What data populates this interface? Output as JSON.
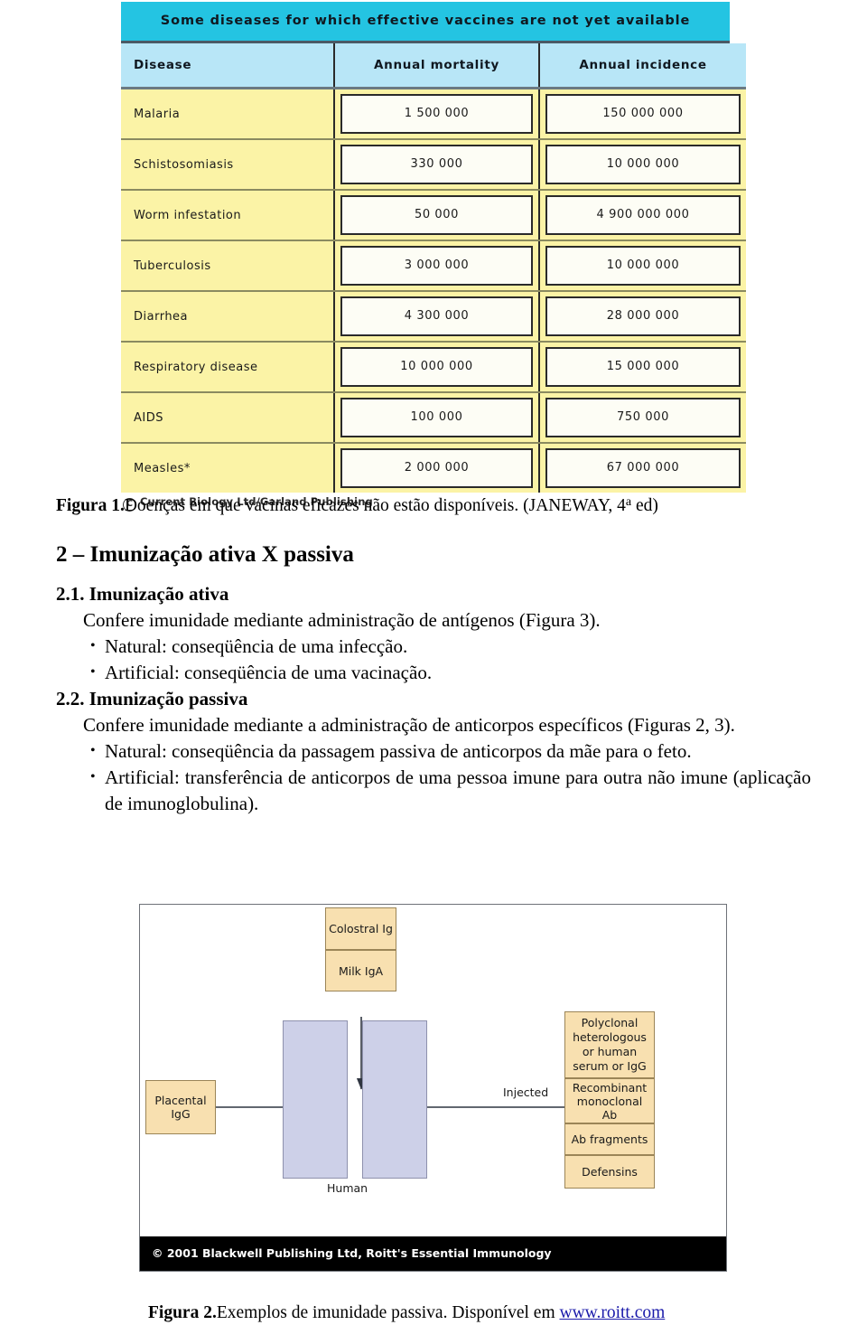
{
  "figure1": {
    "table_title": "Some diseases for which effective vaccines are not yet available",
    "columns": [
      "Disease",
      "Annual mortality",
      "Annual incidence"
    ],
    "rows": [
      {
        "disease": "Malaria",
        "mortality": "1 500 000",
        "incidence": "150 000 000"
      },
      {
        "disease": "Schistosomiasis",
        "mortality": "330 000",
        "incidence": "10 000 000"
      },
      {
        "disease": "Worm  infestation",
        "mortality": "50 000",
        "incidence": "4 900 000 000"
      },
      {
        "disease": "Tuberculosis",
        "mortality": "3 000 000",
        "incidence": "10 000 000"
      },
      {
        "disease": "Diarrhea",
        "mortality": "4 300 000",
        "incidence": "28 000 000"
      },
      {
        "disease": "Respiratory  disease",
        "mortality": "10 000 000",
        "incidence": "15 000 000"
      },
      {
        "disease": "AIDS",
        "mortality": "100 000",
        "incidence": "750 000"
      },
      {
        "disease": "Measles*",
        "mortality": "2 000 000",
        "incidence": "67 000 000"
      }
    ],
    "credit_symbol": "C",
    "credit": "Current Biology Ltd/Garland Publishing",
    "caption_label": "Figura 1.",
    "caption_text": "Doenças em que vacinas eficazes não estão disponíveis. (JANEWAY, 4",
    "caption_sup": "a",
    "caption_tail": " ed)",
    "colors": {
      "title_bar": "#24c4e2",
      "header_row": "#b8e6f7",
      "data_row": "#fbf3a6",
      "value_box": "#fdfdf5"
    }
  },
  "content": {
    "section_heading": "2 – Imunização ativa X passiva",
    "sub1_heading": "2.1. Imunização ativa",
    "sub1_paragraph": "Confere imunidade mediante administração de antígenos (Figura 3).",
    "sub1_bullets": [
      "Natural: conseqüência de uma infecção.",
      "Artificial: conseqüência de uma vacinação."
    ],
    "sub2_heading": "2.2. Imunização passiva",
    "sub2_paragraph": "Confere imunidade mediante a administração de anticorpos específicos (Figuras 2, 3).",
    "sub2_bullets": [
      "Natural: conseqüência da passagem passiva de anticorpos da mãe para o feto.",
      "Artificial: transferência de anticorpos de uma pessoa imune para outra não imune (aplicação de imunoglobulina)."
    ]
  },
  "figure2": {
    "boxes": {
      "colostral": "Colostral Ig",
      "milk": "Milk IgA",
      "placental": "Placental IgG",
      "polyclonal": "Polyclonal heterologous or human serum or IgG",
      "recombinant": "Recombinant monoclonal Ab",
      "fragments": "Ab fragments",
      "defensins": "Defensins"
    },
    "labels": {
      "human": "Human",
      "injected": "Injected"
    },
    "footer": "© 2001 Blackwell Publishing Ltd, Roitt's Essential Immunology",
    "caption_label": "Figura 2.",
    "caption_text": "Exemplos de imunidade passiva. Disponível em ",
    "caption_link": "www.roitt.com",
    "colors": {
      "box_fill": "#f8e0b0",
      "body_fill": "#cdd0e8",
      "footer_bg": "#000000"
    }
  }
}
